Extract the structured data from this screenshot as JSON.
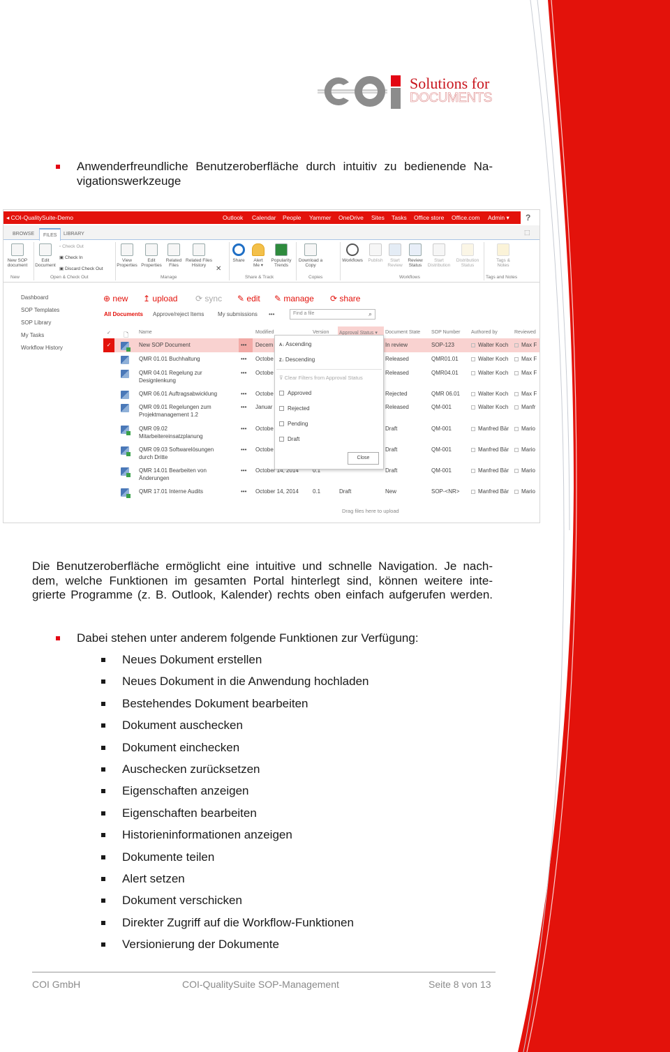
{
  "logo": {
    "brand": "COI",
    "tagline_1": "Solutions for",
    "tagline_2": "DOCUMENTS",
    "colors": {
      "gray": "#8c8c8c",
      "red": "#e30613"
    }
  },
  "intro_bullet": [
    "Anwenderfreundliche Benutzeroberfläche durch intuitiv zu bedienende Na-",
    "vigationswerkzeuge"
  ],
  "screenshot": {
    "site_title": "COI-QualitySuite-Demo",
    "top_nav": [
      "Outlook",
      "Calendar",
      "People",
      "Yammer",
      "OneDrive",
      "Sites",
      "Tasks",
      "Office store",
      "Office.com",
      "Admin ▾"
    ],
    "help": "?",
    "tabs": [
      "BROWSE",
      "FILES",
      "LIBRARY"
    ],
    "ribbon": {
      "new_sop": [
        "New SOP",
        "document"
      ],
      "edit_document": [
        "Edit",
        "Document"
      ],
      "check_out": "Check Out",
      "check_in": "Check In",
      "discard": "Discard Check Out",
      "view_props": [
        "View",
        "Properties"
      ],
      "edit_props": [
        "Edit",
        "Properties"
      ],
      "related": [
        "Related",
        "Files"
      ],
      "related_hist": [
        "Related Files",
        "History"
      ],
      "share": "Share",
      "alert": [
        "Alert",
        "Me ▾"
      ],
      "popularity": [
        "Popularity",
        "Trends"
      ],
      "download": [
        "Download a",
        "Copy"
      ],
      "workflows": "Workflows",
      "publish": "Publish",
      "start_review": [
        "Start",
        "Review"
      ],
      "review_status": [
        "Review",
        "Status"
      ],
      "start_dist": [
        "Start",
        "Distribution"
      ],
      "dist_status": [
        "Distribution",
        "Status"
      ],
      "tags": [
        "Tags &",
        "Notes"
      ],
      "groups": [
        "New",
        "Open & Check Out",
        "Manage",
        "Share & Track",
        "Copies",
        "Workflows",
        "Tags and Notes"
      ]
    },
    "left_nav": [
      "Dashboard",
      "SOP Templates",
      "SOP Library",
      "My Tasks",
      "Workflow History"
    ],
    "commands": [
      "⊕ new",
      "↥ upload",
      "⟳ sync",
      "✎ edit",
      "✎ manage",
      "⟳ share"
    ],
    "views": [
      "All Documents",
      "Approve/reject Items",
      "My submissions",
      "•••"
    ],
    "search_placeholder": "Find a file",
    "columns": [
      "✓",
      "Name",
      "Modified",
      "Version",
      "Approval Status ▾",
      "Document State",
      "SOP Number",
      "Authored by",
      "Reviewed"
    ],
    "rows": [
      {
        "name": [
          "New SOP Document"
        ],
        "modified": "Decem",
        "version": "",
        "state": "In review",
        "sop": "SOP-123",
        "author": "Walter Koch",
        "reviewed": "Max F",
        "selected": true
      },
      {
        "name": [
          "QMR 01.01 Buchhaltung"
        ],
        "modified": "Octobe",
        "version": "",
        "state": "Released",
        "sop": "QMR01.01",
        "author": "Walter Koch",
        "reviewed": "Max F"
      },
      {
        "name": [
          "QMR 04.01 Regelung zur",
          "Designlenkung"
        ],
        "modified": "Octobe",
        "version": "",
        "state": "Released",
        "sop": "QMR04.01",
        "author": "Walter Koch",
        "reviewed": "Max F"
      },
      {
        "name": [
          "QMR 06.01 Auftragsabwicklung"
        ],
        "modified": "Octobe",
        "version": "",
        "state": "Rejected",
        "sop": "QMR 06.01",
        "author": "Walter Koch",
        "reviewed": "Max F"
      },
      {
        "name": [
          "QMR 09.01 Regelungen zum",
          "Projektmanagement 1.2"
        ],
        "modified": "Januar",
        "version": "",
        "state": "Released",
        "sop": "QM-001",
        "author": "Walter Koch",
        "reviewed": "Manfr"
      },
      {
        "name": [
          "QMR 09.02",
          "Mitarbeitereinsatzplanung"
        ],
        "modified": "Octobe",
        "version": "",
        "state": "Draft",
        "sop": "QM-001",
        "author": "Manfred Bär",
        "reviewed": "Mario"
      },
      {
        "name": [
          "QMR 09.03 Softwarelösungen",
          "durch Dritte"
        ],
        "modified": "Octobe",
        "version": "",
        "state": "Draft",
        "sop": "QM-001",
        "author": "Manfred Bär",
        "reviewed": "Mario"
      },
      {
        "name": [
          "QMR 14.01 Bearbeiten von",
          "Änderungen"
        ],
        "modified": "October 14, 2014",
        "version": "0.1",
        "state": "Draft",
        "sop": "QM-001",
        "author": "Manfred Bär",
        "reviewed": "Mario"
      },
      {
        "name": [
          "QMR 17.01 Interne Audits"
        ],
        "modified": "October 14, 2014",
        "version": "0.1",
        "approval": "Draft",
        "state": "New",
        "sop": "SOP-<NR>",
        "author": "Manfred Bär",
        "reviewed": "Mario"
      }
    ],
    "dropdown": {
      "ascending": "Ascending",
      "descending": "Descending",
      "clear": "Clear Filters from Approval Status",
      "options": [
        "Approved",
        "Rejected",
        "Pending",
        "Draft"
      ],
      "close": "Close"
    },
    "drag_hint": "Drag files here to upload",
    "colors": {
      "accent": "#e3120b",
      "selected_row": "#f9d2d0"
    }
  },
  "paragraph": [
    "Die Benutzeroberfläche ermöglicht eine intuitive und schnelle Navigation. Je nach-",
    "dem, welche Funktionen im gesamten Portal hinterlegt sind, können weitere inte-",
    "grierte Programme (z. B. Outlook, Kalender) rechts oben einfach aufgerufen werden."
  ],
  "functions_intro": "Dabei stehen unter anderem folgende Funktionen zur Verfügung:",
  "functions": [
    "Neues Dokument erstellen",
    "Neues Dokument in die Anwendung hochladen",
    "Bestehendes Dokument bearbeiten",
    "Dokument auschecken",
    "Dokument einchecken",
    "Auschecken zurücksetzen",
    "Eigenschaften anzeigen",
    "Eigenschaften bearbeiten",
    "Historieninformationen anzeigen",
    "Dokumente teilen",
    "Alert setzen",
    "Dokument verschicken",
    "Direkter Zugriff auf die Workflow-Funktionen",
    "Versionierung der Dokumente"
  ],
  "footer": {
    "company": "COI GmbH",
    "product": "COI-QualitySuite SOP-Management",
    "page": "Seite 8 von 13"
  }
}
